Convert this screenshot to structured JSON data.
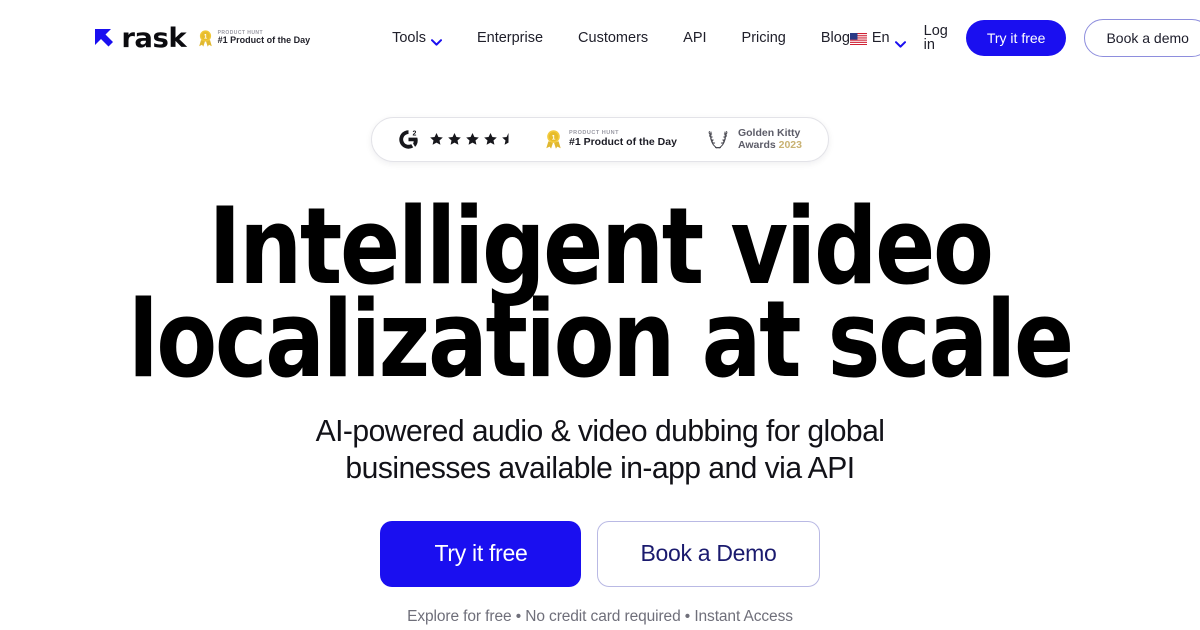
{
  "brand": {
    "logo_icon": "rask-arrow-logo-icon",
    "name": "rask",
    "producthunt": {
      "medal_icon": "product-hunt-medal-icon",
      "kicker": "PRODUCT HUNT",
      "title": "#1 Product of the Day"
    }
  },
  "nav": {
    "items": [
      {
        "label": "Tools",
        "has_chevron": true,
        "chevron_icon": "chevron-down-icon"
      },
      {
        "label": "Enterprise",
        "has_chevron": false
      },
      {
        "label": "Customers",
        "has_chevron": false
      },
      {
        "label": "API",
        "has_chevron": false
      },
      {
        "label": "Pricing",
        "has_chevron": false
      },
      {
        "label": "Blog",
        "has_chevron": false
      }
    ]
  },
  "header_right": {
    "language": {
      "flag_icon": "us-flag-icon",
      "label": "En",
      "chevron_icon": "chevron-down-icon"
    },
    "login_label": "Log in",
    "try_free_label": "Try it free",
    "book_demo_label": "Book a demo"
  },
  "badges": {
    "g2": {
      "logo_icon": "g2-logo-icon",
      "rating": 4.5,
      "stars_total": 5
    },
    "producthunt": {
      "medal_icon": "product-hunt-medal-icon",
      "kicker": "PRODUCT HUNT",
      "title": "#1 Product of the Day"
    },
    "golden_kitty": {
      "wreath_icon": "laurel-wreath-icon",
      "line1": "Golden Kitty",
      "line2": "Awards",
      "year": "2023"
    }
  },
  "hero": {
    "headline_line1": "Intelligent video",
    "headline_line2": "localization at scale",
    "subhead_line1": "AI-powered audio & video dubbing for global",
    "subhead_line2": "businesses available in-app and via API",
    "primary_cta": "Try it free",
    "secondary_cta": "Book a Demo",
    "note": "Explore for free • No credit card required • Instant Access"
  },
  "colors": {
    "accent_blue": "#1a0ff0",
    "text_dark": "#0b0b0f",
    "muted_gray": "#6f6f7a",
    "gold": "#c9b273"
  }
}
